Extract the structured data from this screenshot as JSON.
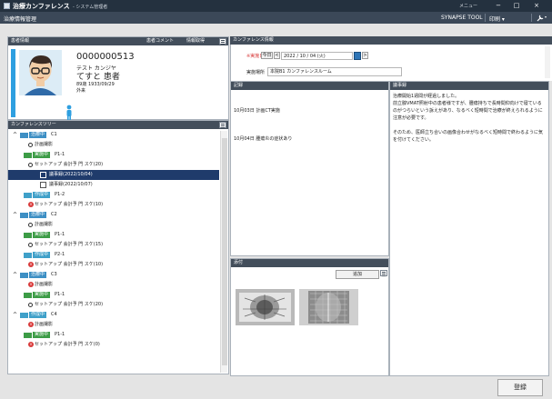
{
  "window": {
    "app_title": "治療カンファレンス",
    "role": "- システム管理者",
    "menu_label": "メニュー",
    "min": "−",
    "max": "□",
    "close": "×"
  },
  "subbar": {
    "title": "治療情報管理",
    "synapse": "SYNAPSE TOOL",
    "print": "印刷",
    "wrench_icon": "wrench-icon"
  },
  "patient_panel": {
    "title": "患者情報",
    "comment_btn": "患者コメント",
    "info_btn": "情報取得",
    "id": "0000000513",
    "kana": "テスト カンジヤ",
    "name": "てすと 患者",
    "birth": "89歳 1933/09/29",
    "dept": "外来"
  },
  "tree_panel": {
    "title": "カンファレンスツリー",
    "rows": [
      {
        "caret": "^",
        "tag": "治療中",
        "tag_color": "#3d8fc4",
        "text": "C1"
      },
      {
        "text": "計画撮影",
        "ring": true
      },
      {
        "tag": "実施中",
        "tag_color": "#3c9c46",
        "text": "P1-1"
      },
      {
        "text": "セットアップ 会計予 門 スケ(20)",
        "status": true
      },
      {
        "text": "議事録(2022/10/04)",
        "sel": true
      },
      {
        "text": "議事録(2022/10/07)"
      },
      {
        "tag": "作成中",
        "tag_color": "#3fa0c9",
        "text": "P1-2"
      },
      {
        "text": "セットアップ 会計予 門 スケ(10)",
        "status": true,
        "xfirst": true
      },
      {
        "caret": "^",
        "tag": "治療中",
        "tag_color": "#3d8fc4",
        "text": "C2"
      },
      {
        "text": "計画撮影",
        "ring": true
      },
      {
        "tag": "実施中",
        "tag_color": "#3c9c46",
        "text": "P1-1"
      },
      {
        "text": "セットアップ 会計予 門 スケ(15)",
        "status": true
      },
      {
        "tag": "作成中",
        "tag_color": "#3fa0c9",
        "text": "P2-1"
      },
      {
        "text": "セットアップ 会計予 門 スケ(10)",
        "status": true,
        "xfirst": true
      },
      {
        "caret": "^",
        "tag": "治療中",
        "tag_color": "#3d8fc4",
        "text": "C3"
      },
      {
        "text": "計画撮影",
        "xmark": true
      },
      {
        "tag": "実施中",
        "tag_color": "#3c9c46",
        "text": "P1-1"
      },
      {
        "text": "セットアップ 会計予 門 スケ(20)",
        "status": true
      },
      {
        "caret": "^",
        "tag": "作成中",
        "tag_color": "#3fa0c9",
        "text": "C4"
      },
      {
        "text": "計画撮影",
        "xmark": true
      },
      {
        "tag": "実施中",
        "tag_color": "#3c9c46",
        "text": "P1-1"
      },
      {
        "text": "セットアップ 会計予 門 スケ(0)",
        "status": true,
        "xfirst": true
      }
    ]
  },
  "conference": {
    "title": "カンファレンス情報",
    "date_label": "※実施日",
    "today_btn": "今日",
    "prev_btn": "<",
    "date_value": "2022 / 10 / 04 (火)",
    "next_btn": ">",
    "place_label": "実施場所",
    "place_value": "本院B1 カンファレンスルーム"
  },
  "record_panel": {
    "title": "記録",
    "lines": [
      "10月03日 計画CT実施",
      "10月04日 腫瘍炎の症状あり"
    ]
  },
  "minutes_panel": {
    "title": "議事録",
    "text": "治療開始1週間が経過しました。\n前立腺VMAT照射中の患者様ですが、腫瘍持ちで長時間仰向けで寝ているのがつらいという訴えがあり、なるべく短時間で治療が終えられるように注意が必要です。\n\nそのため、医師立ち合いの画像合わせがなるべく短時間で終わるように気を付けてください。"
  },
  "attach_panel": {
    "title": "添付",
    "add_btn": "追加"
  },
  "footer": {
    "register_btn": "登録"
  },
  "colors": {
    "header_dark": "#24313f",
    "panel_header": "#434e5b",
    "selection": "#1f3b6b",
    "avatar_accent": "#2e9fe0"
  }
}
